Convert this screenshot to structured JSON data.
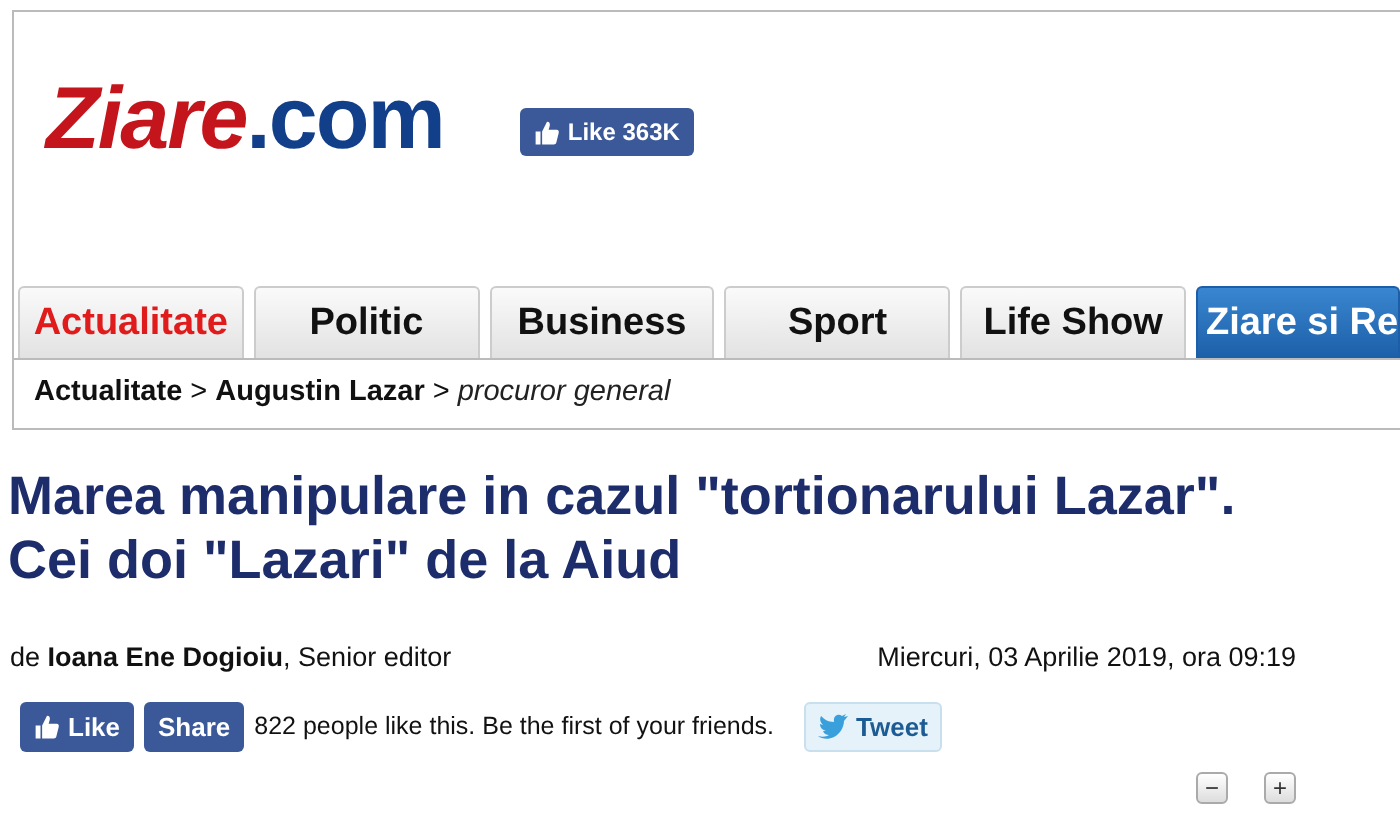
{
  "logo": {
    "main": "Ziare",
    "suffix": ".com"
  },
  "like_badge": {
    "label": "Like",
    "count": "363K"
  },
  "tabs": [
    {
      "label": "Actualitate",
      "selected": true,
      "kind": "section"
    },
    {
      "label": "Politic",
      "selected": false,
      "kind": "section"
    },
    {
      "label": "Business",
      "selected": false,
      "kind": "section"
    },
    {
      "label": "Sport",
      "selected": false,
      "kind": "section"
    },
    {
      "label": "Life Show",
      "selected": false,
      "kind": "section"
    },
    {
      "label": "Ziare si Re",
      "selected": false,
      "kind": "highlight"
    }
  ],
  "breadcrumb": [
    {
      "text": "Actualitate",
      "kind": "link"
    },
    {
      "text": ">",
      "kind": "separator"
    },
    {
      "text": "Augustin Lazar",
      "kind": "link"
    },
    {
      "text": ">",
      "kind": "separator"
    },
    {
      "text": "procuror general",
      "kind": "current"
    }
  ],
  "headline": "Marea manipulare in cazul \"tortionarului Lazar\". Cei doi \"Lazari\" de la Aiud",
  "byline": "de **Ioana Ene Dogioiu**, Senior editor",
  "date": "Miercuri, 03 Aprilie 2019, ora 09:19",
  "social": {
    "like": "Like",
    "share": "Share",
    "text": "822 people like this. Be the first of your friends.",
    "tweet": "Tweet"
  },
  "zoom_buttons": [
    "−",
    "+"
  ]
}
